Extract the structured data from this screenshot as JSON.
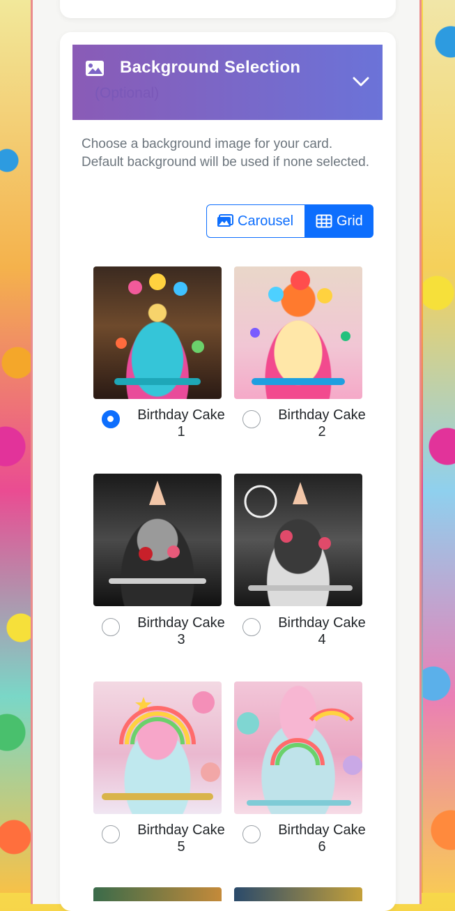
{
  "section": {
    "title": "Background Selection",
    "optional_label": "(Optional)",
    "description": "Choose a background image for your card. Default background will be used if none selected."
  },
  "view_toggle": {
    "carousel_label": "Carousel",
    "grid_label": "Grid",
    "active": "Grid"
  },
  "backgrounds": [
    {
      "label": "Birthday Cake 1",
      "selected": true
    },
    {
      "label": "Birthday Cake 2",
      "selected": false
    },
    {
      "label": "Birthday Cake 3",
      "selected": false
    },
    {
      "label": "Birthday Cake 4",
      "selected": false
    },
    {
      "label": "Birthday Cake 5",
      "selected": false
    },
    {
      "label": "Birthday Cake 6",
      "selected": false
    }
  ],
  "colors": {
    "header_gradient_start": "#8a5bb6",
    "header_gradient_end": "#6b73d8",
    "accent": "#0d6efd",
    "frame_border": "#ea8c8c"
  },
  "icons": {
    "header": "image-icon",
    "collapse": "chevron-down-icon",
    "carousel": "images-icon",
    "grid": "grid-icon"
  }
}
